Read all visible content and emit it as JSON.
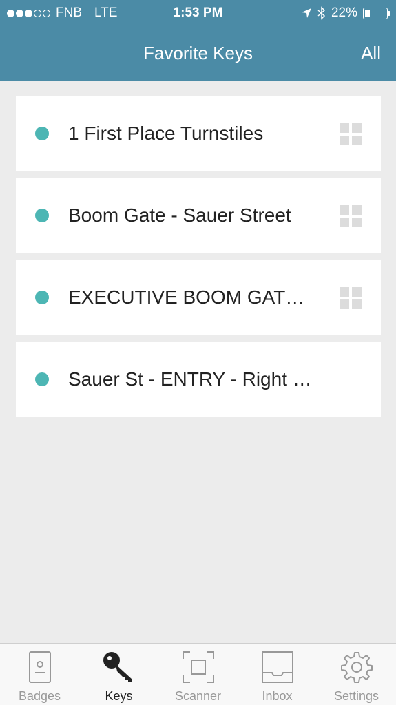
{
  "status_bar": {
    "carrier": "FNB",
    "network": "LTE",
    "time": "1:53 PM",
    "battery": "22%",
    "battery_level": 0.22,
    "signal_bars_filled": 3,
    "signal_bars_total": 5
  },
  "nav": {
    "title": "Favorite Keys",
    "right_action": "All"
  },
  "keys": [
    {
      "label": "1 First Place Turnstiles",
      "has_qr": true
    },
    {
      "label": "Boom Gate - Sauer Street",
      "has_qr": true
    },
    {
      "label": "EXECUTIVE BOOM GAT…",
      "has_qr": true
    },
    {
      "label": "Sauer St - ENTRY - Right Bo…",
      "has_qr": false
    }
  ],
  "tabs": [
    {
      "label": "Badges",
      "icon": "badge-icon",
      "active": false
    },
    {
      "label": "Keys",
      "icon": "key-icon",
      "active": true
    },
    {
      "label": "Scanner",
      "icon": "scanner-icon",
      "active": false
    },
    {
      "label": "Inbox",
      "icon": "inbox-icon",
      "active": false
    },
    {
      "label": "Settings",
      "icon": "gear-icon",
      "active": false
    }
  ],
  "colors": {
    "header": "#4b8ba6",
    "bullet": "#4db6b4",
    "background": "#ececec"
  }
}
